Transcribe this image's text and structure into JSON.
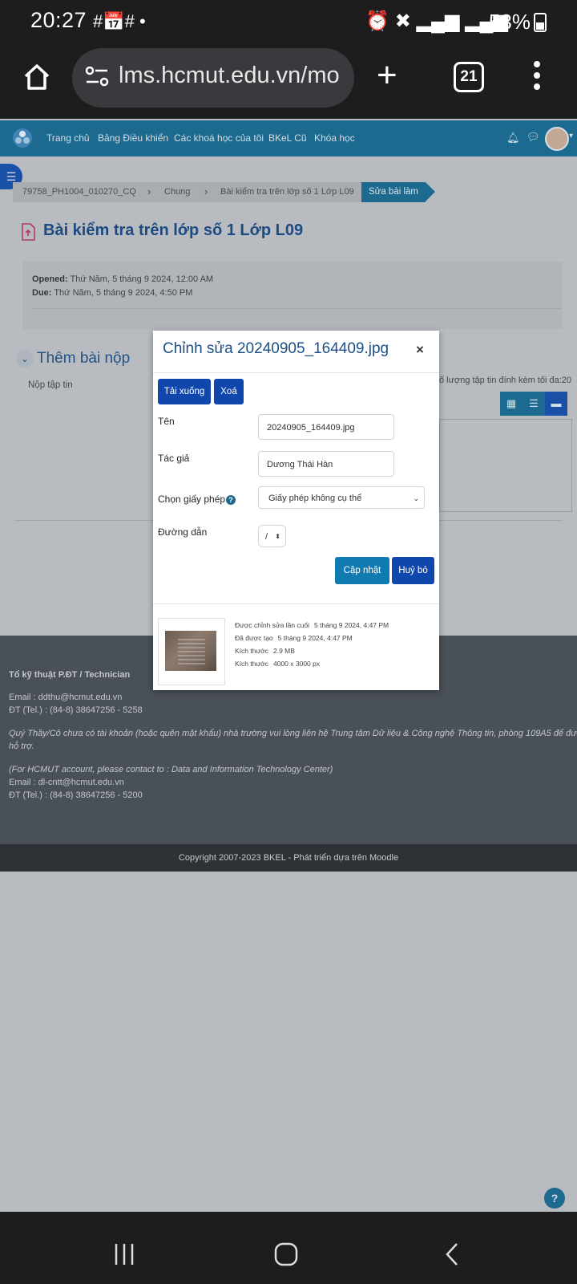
{
  "status_bar": {
    "time": "20:27",
    "battery": "53%"
  },
  "browser": {
    "url": "lms.hcmut.edu.vn/mo",
    "tab_count": "21"
  },
  "nav": {
    "items": [
      "Trang chủ",
      "Bảng Điều khiển",
      "Các khoá học của tôi",
      "BKeL Cũ",
      "Khóa học"
    ]
  },
  "breadcrumb": {
    "items": [
      "79758_PH1004_010270_CQ",
      "Chung",
      "Bài kiểm tra trên lớp số 1 Lớp L09"
    ],
    "active": "Sửa bài làm"
  },
  "page": {
    "title": "Bài kiểm tra trên lớp số 1 Lớp L09",
    "opened_label": "Opened:",
    "opened_value": "Thứ Năm, 5 tháng 9 2024, 12:00 AM",
    "due_label": "Due:",
    "due_value": "Thứ Năm, 5 tháng 9 2024, 4:50 PM",
    "section_title": "Thêm bài nộp",
    "file_label": "Nộp tập tin",
    "max_files": "ố lượng tập tin đính kèm tối đa:20"
  },
  "modal": {
    "title": "Chỉnh sửa 20240905_164409.jpg",
    "close": "×",
    "download_label": "Tải xuống",
    "delete_label": "Xoá",
    "name_label": "Tên",
    "name_value": "20240905_164409.jpg",
    "author_label": "Tác giả",
    "author_value": "Dương Thái Hàn",
    "license_label": "Chọn giấy phép",
    "license_value": "Giấy phép không cụ thể",
    "path_label": "Đường dẫn",
    "path_value": "/",
    "update_label": "Cập nhật",
    "cancel_label": "Huỷ bỏ",
    "meta": {
      "modified_label": "Được chỉnh sửa lần cuối",
      "modified_value": "5 tháng 9 2024, 4:47 PM",
      "created_label": "Đã được tạo",
      "created_value": "5 tháng 9 2024, 4:47 PM",
      "size_label": "Kích thước",
      "size_value": "2.9 MB",
      "dims_label": "Kích thước",
      "dims_value": "4000 x 3000 px"
    }
  },
  "footer": {
    "heading": "Tổ kỹ thuật P.ĐT / Technician",
    "email1": "Email : ddthu@hcmut.edu.vn",
    "tel1": "ĐT (Tel.) : (84-8) 38647256 - 5258",
    "notice_line1": "Quý Thầy/Cô chưa có tài khoản (hoặc quên mật khẩu) nhà trường vui lòng liên hệ Trung tâm Dữ liệu & Công nghệ Thông tin, phòng 109A5 để được",
    "notice_line2": "hỗ trợ.",
    "hcmut_note": "(For HCMUT account, please contact to : Data and Information Technology Center)",
    "email2": "Email : dl-cntt@hcmut.edu.vn",
    "tel2": "ĐT (Tel.) : (84-8) 38647256 - 5200",
    "copyright": "Copyright 2007-2023 BKEL - Phát triển dựa trên Moodle"
  },
  "help": "?"
}
